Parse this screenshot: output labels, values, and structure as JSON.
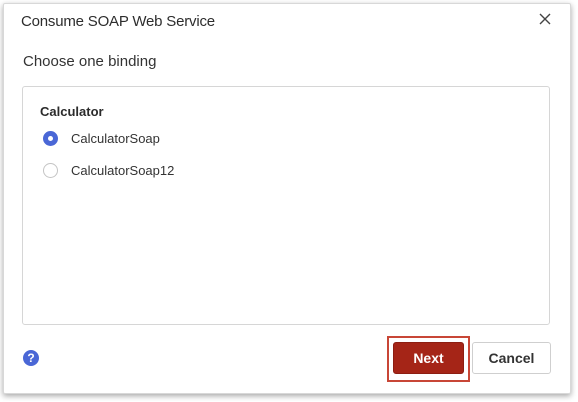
{
  "dialog": {
    "title": "Consume SOAP Web Service",
    "subtitle": "Choose one binding",
    "group_label": "Calculator",
    "options": [
      {
        "label": "CalculatorSoap",
        "selected": true
      },
      {
        "label": "CalculatorSoap12",
        "selected": false
      }
    ],
    "help_label": "?",
    "next_label": "Next",
    "cancel_label": "Cancel"
  },
  "colors": {
    "accent": "#4a67d6",
    "primary_button": "#a52517",
    "highlight": "#c84636"
  },
  "icons": {
    "close": "close-icon",
    "help": "help-icon"
  }
}
